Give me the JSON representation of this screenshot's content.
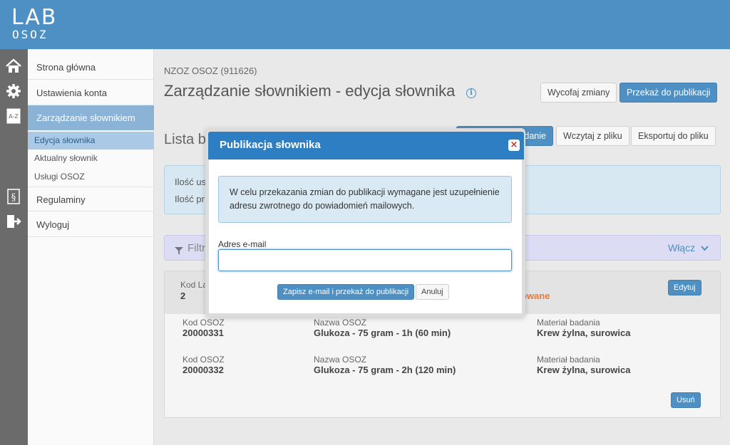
{
  "logo": {
    "top": "LAB",
    "bottom": "OSOZ"
  },
  "sidebar": {
    "items": [
      {
        "label": "Strona główna",
        "icon": "home-icon"
      },
      {
        "label": "Ustawienia konta",
        "icon": "gear-icon"
      },
      {
        "label": "Zarządzanie słownikiem",
        "icon": "dictionary-az-icon"
      },
      {
        "label": "Regulaminy",
        "icon": "paragraph-icon"
      },
      {
        "label": "Wyloguj",
        "icon": "logout-icon"
      }
    ],
    "subitems": [
      {
        "label": "Edycja słownika"
      },
      {
        "label": "Aktualny słownik"
      },
      {
        "label": "Usługi OSOZ"
      }
    ]
  },
  "main": {
    "breadcrumb": "NZOZ OSOZ (911626)",
    "title": "Zarządzanie słownikiem - edycja słownika",
    "actions": {
      "revert": "Wycofaj zmiany",
      "publish": "Przekaż do publikacji"
    },
    "section_title": "Lista ba",
    "toolbar": {
      "add_partial": "danie",
      "import": "Wczytaj z pliku",
      "export": "Eksportuj do pliku"
    },
    "info": {
      "line1": "Ilość us",
      "line2": "Ilość pr"
    },
    "filter": {
      "label": "Filtr",
      "toggle": "Włącz"
    },
    "card": {
      "head_code_label": "Kod La",
      "head_code_value": "2",
      "head_status_partial": "owane",
      "edit": "Edytuj",
      "remove": "Usuń",
      "rows": [
        {
          "code_label": "Kod OSOZ",
          "code": "20000331",
          "name_label": "Nazwa OSOZ",
          "name": "Glukoza - 75 gram - 1h (60 min)",
          "material_label": "Materiał badania",
          "material": "Krew żylna, surowica"
        },
        {
          "code_label": "Kod OSOZ",
          "code": "20000332",
          "name_label": "Nazwa OSOZ",
          "name": "Glukoza - 75 gram - 2h (120 min)",
          "material_label": "Materiał badania",
          "material": "Krew żylna, surowica"
        }
      ]
    }
  },
  "modal": {
    "title": "Publikacja słownika",
    "close": "×",
    "message": "W celu przekazania zmian do publikacji wymagane jest uzupełnienie adresu zwrotnego do powiadomień mailowych.",
    "email_label": "Adres e-mail",
    "email_value": "",
    "submit": "Zapisz e-mail i przekaż do publikacji",
    "cancel": "Anuluj"
  },
  "colors": {
    "header": "#4f90c4",
    "modal_header": "#2d7ec3",
    "warning": "#e47a3c"
  }
}
